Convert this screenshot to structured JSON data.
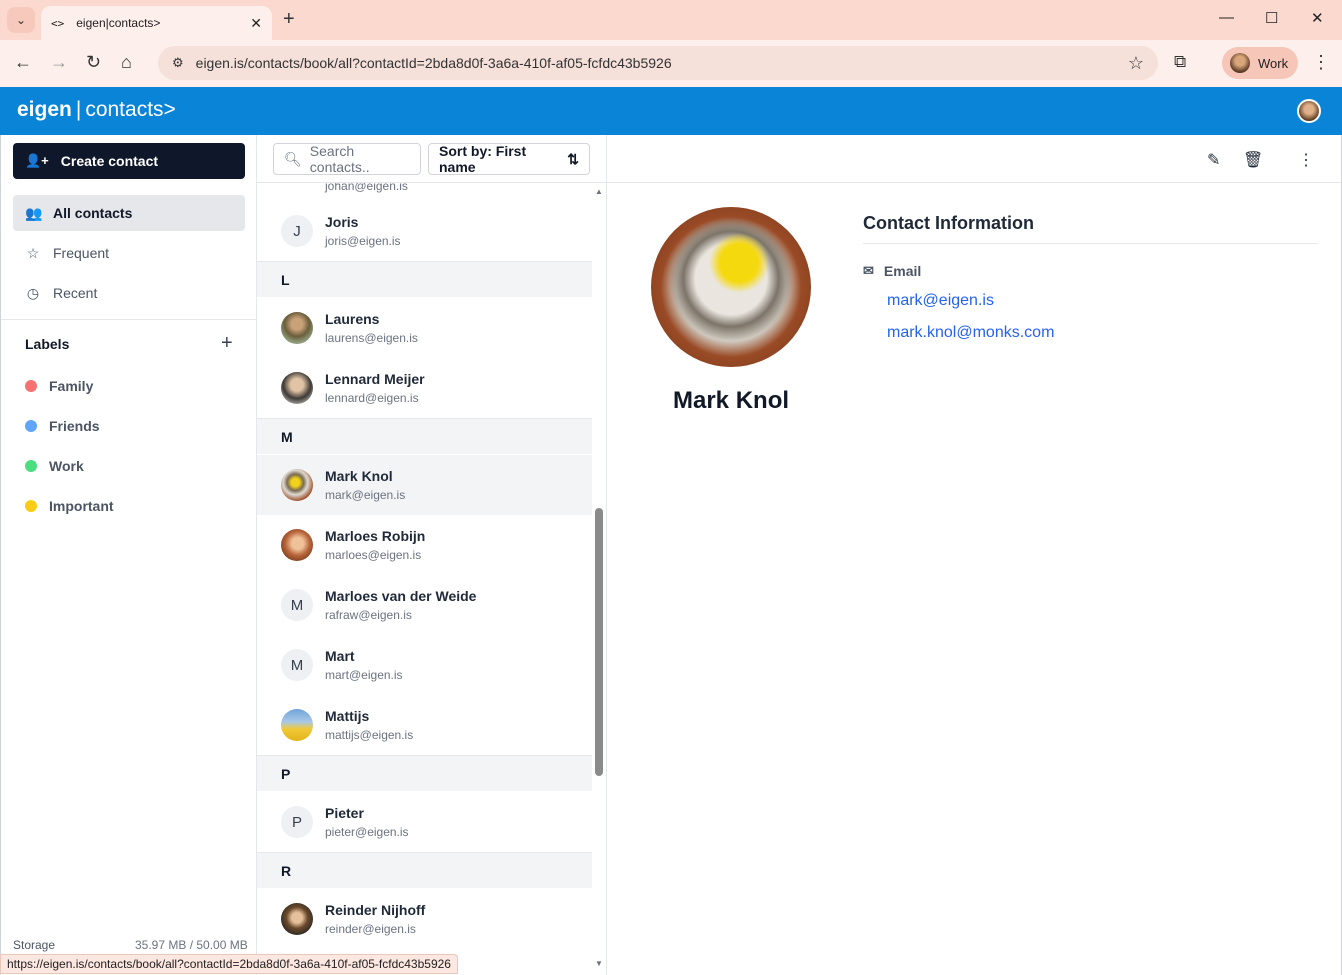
{
  "browser": {
    "tab_title": "eigen|contacts>",
    "url": "eigen.is/contacts/book/all?contactId=2bda8d0f-3a6a-410f-af05-fcfdc43b5926",
    "profile_label": "Work",
    "status_url": "https://eigen.is/contacts/book/all?contactId=2bda8d0f-3a6a-410f-af05-fcfdc43b5926"
  },
  "app": {
    "brand_bold": "eigen",
    "brand_sep": "|",
    "brand_light": "contacts>",
    "accent": "#0a84d6"
  },
  "sidebar": {
    "create_label": "Create contact",
    "nav": [
      {
        "label": "All contacts",
        "icon": "users-icon",
        "active": true
      },
      {
        "label": "Frequent",
        "icon": "star-icon"
      },
      {
        "label": "Recent",
        "icon": "clock-icon"
      }
    ],
    "labels_heading": "Labels",
    "labels": [
      {
        "label": "Family",
        "color": "#f87171"
      },
      {
        "label": "Friends",
        "color": "#60a5fa"
      },
      {
        "label": "Work",
        "color": "#4ade80"
      },
      {
        "label": "Important",
        "color": "#facc15"
      }
    ],
    "storage_label": "Storage",
    "storage_value": "35.97 MB / 50.00 MB"
  },
  "list": {
    "search_placeholder": "Search contacts..",
    "sort_label": "Sort by: First name",
    "partial_email": "johan@eigen.is",
    "contacts": [
      {
        "name": "Joris",
        "email": "joris@eigen.is",
        "initial": "J"
      },
      {
        "letter": "L"
      },
      {
        "name": "Laurens",
        "email": "laurens@eigen.is",
        "photo": "laurens"
      },
      {
        "name": "Lennard Meijer",
        "email": "lennard@eigen.is",
        "photo": "lennard"
      },
      {
        "letter": "M"
      },
      {
        "name": "Mark Knol",
        "email": "mark@eigen.is",
        "photo": "mark",
        "selected": true
      },
      {
        "name": "Marloes Robijn",
        "email": "marloes@eigen.is",
        "photo": "marloes"
      },
      {
        "name": "Marloes van der Weide",
        "email": "rafraw@eigen.is",
        "initial": "M"
      },
      {
        "name": "Mart",
        "email": "mart@eigen.is",
        "initial": "M"
      },
      {
        "name": "Mattijs",
        "email": "mattijs@eigen.is",
        "photo": "mattijs"
      },
      {
        "letter": "P"
      },
      {
        "name": "Pieter",
        "email": "pieter@eigen.is",
        "initial": "P"
      },
      {
        "letter": "R"
      },
      {
        "name": "Reinder Nijhoff",
        "email": "reinder@eigen.is",
        "photo": "reinder"
      }
    ]
  },
  "detail": {
    "name": "Mark Knol",
    "section_title": "Contact Information",
    "email_label": "Email",
    "emails": [
      "mark@eigen.is",
      "mark.knol@monks.com"
    ]
  }
}
